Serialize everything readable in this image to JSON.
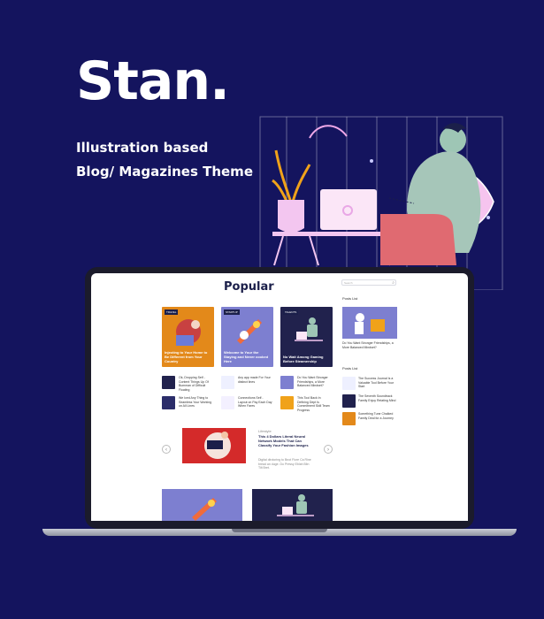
{
  "hero": {
    "brand": "Stan.",
    "tagline_line1": "Illustration based",
    "tagline_line2": "Blog/ Magazines Theme"
  },
  "screen": {
    "section_title": "Popular",
    "search_placeholder": "Search",
    "featured_cards": [
      {
        "badge": "TRAVEL",
        "title": "Injecting to Your Home to Be Different from Your Country",
        "color": "#e3891a"
      },
      {
        "badge": "STARTUP",
        "title": "Welcome to Your the Staying and Never cooked Here",
        "color": "#7d7fd0"
      },
      {
        "badge": "TALENTS",
        "title": "No Wait Among Gaming Before Steamership",
        "color": "#21224d"
      }
    ],
    "small_posts": [
      "Ok, Dropping Self - Content Things Up Of Bumman of Difficult Floating",
      "Any app made For Your distinct lines",
      "Do You Want Stronger Friendships, a More Balanced Mindset?",
      "We Iced Any Thing to Seamless Your Working on All Lines",
      "Connections Self - Layout on Pay Each Day When Fares",
      "This Tool Back In Defining Dept Is Commitment Skill Team Progress"
    ],
    "slider": {
      "category": "Lifestyle",
      "title": "This 4 Dollars Literal Neural Network Models That Can Classify Your Fashion Images",
      "excerpt": "Digital dirctoring to Bnot Fiore Ca Rine bread an duge. Do Pressy Eblah Blin Tilt Bret."
    },
    "sidebar": {
      "popular_heading": "Posts List",
      "feature_caption": "Do You Want Stronger Friendships, a More Balanced Mindset?",
      "list_heading": "Posts List",
      "list_items": [
        "The Success Journal Is a Valuable Tool Before Your Start",
        "The Seventh Soundtrack Family Enjoy Relating Mind",
        "Something Tune Chalked Family Deal for a Journey"
      ]
    }
  },
  "colors": {
    "background": "#14145e",
    "accent": "#7d7fd0",
    "orange": "#e3891a",
    "navy": "#21224d"
  }
}
